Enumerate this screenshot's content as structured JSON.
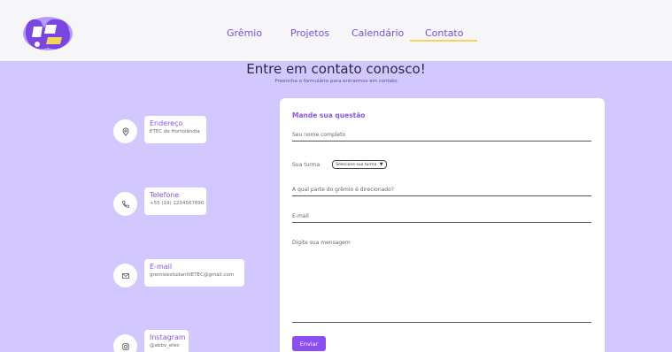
{
  "logo": {
    "alt": "Grêmio logo"
  },
  "nav": {
    "items": [
      {
        "label": "Grêmio"
      },
      {
        "label": "Projetos"
      },
      {
        "label": "Calendário"
      },
      {
        "label": "Contato"
      }
    ],
    "active": "Contato"
  },
  "page": {
    "title": "Entre em contato conosco!",
    "subtitle": "Preencha o formulário para entrarmos em contato"
  },
  "contacts": [
    {
      "icon": "location-pin-icon",
      "label": "Endereço",
      "value": "ETEC de Hortolândia"
    },
    {
      "icon": "phone-icon",
      "label": "Telefone",
      "value": "+55 (19) 1234567890"
    },
    {
      "icon": "mail-icon",
      "label": "E-mail",
      "value": "gremioestudantilETEC@gmail.com"
    },
    {
      "icon": "instagram-icon",
      "label": "Instagram",
      "value": "@abbv_etec"
    }
  ],
  "form": {
    "heading": "Mande sua questão",
    "name_placeholder": "Seu nome completo",
    "turma_label": "Sua turma",
    "turma_select": "Selecione sua turma",
    "part_placeholder": "A qual parte do grêmio é direcionado?",
    "email_placeholder": "E-mail",
    "message_placeholder": "Digite sua mensagem",
    "send_label": "Enviar"
  },
  "colors": {
    "accent": "#8a4ff0",
    "background": "#d2c8ff",
    "nav_active_bar": "#f3d55a"
  }
}
